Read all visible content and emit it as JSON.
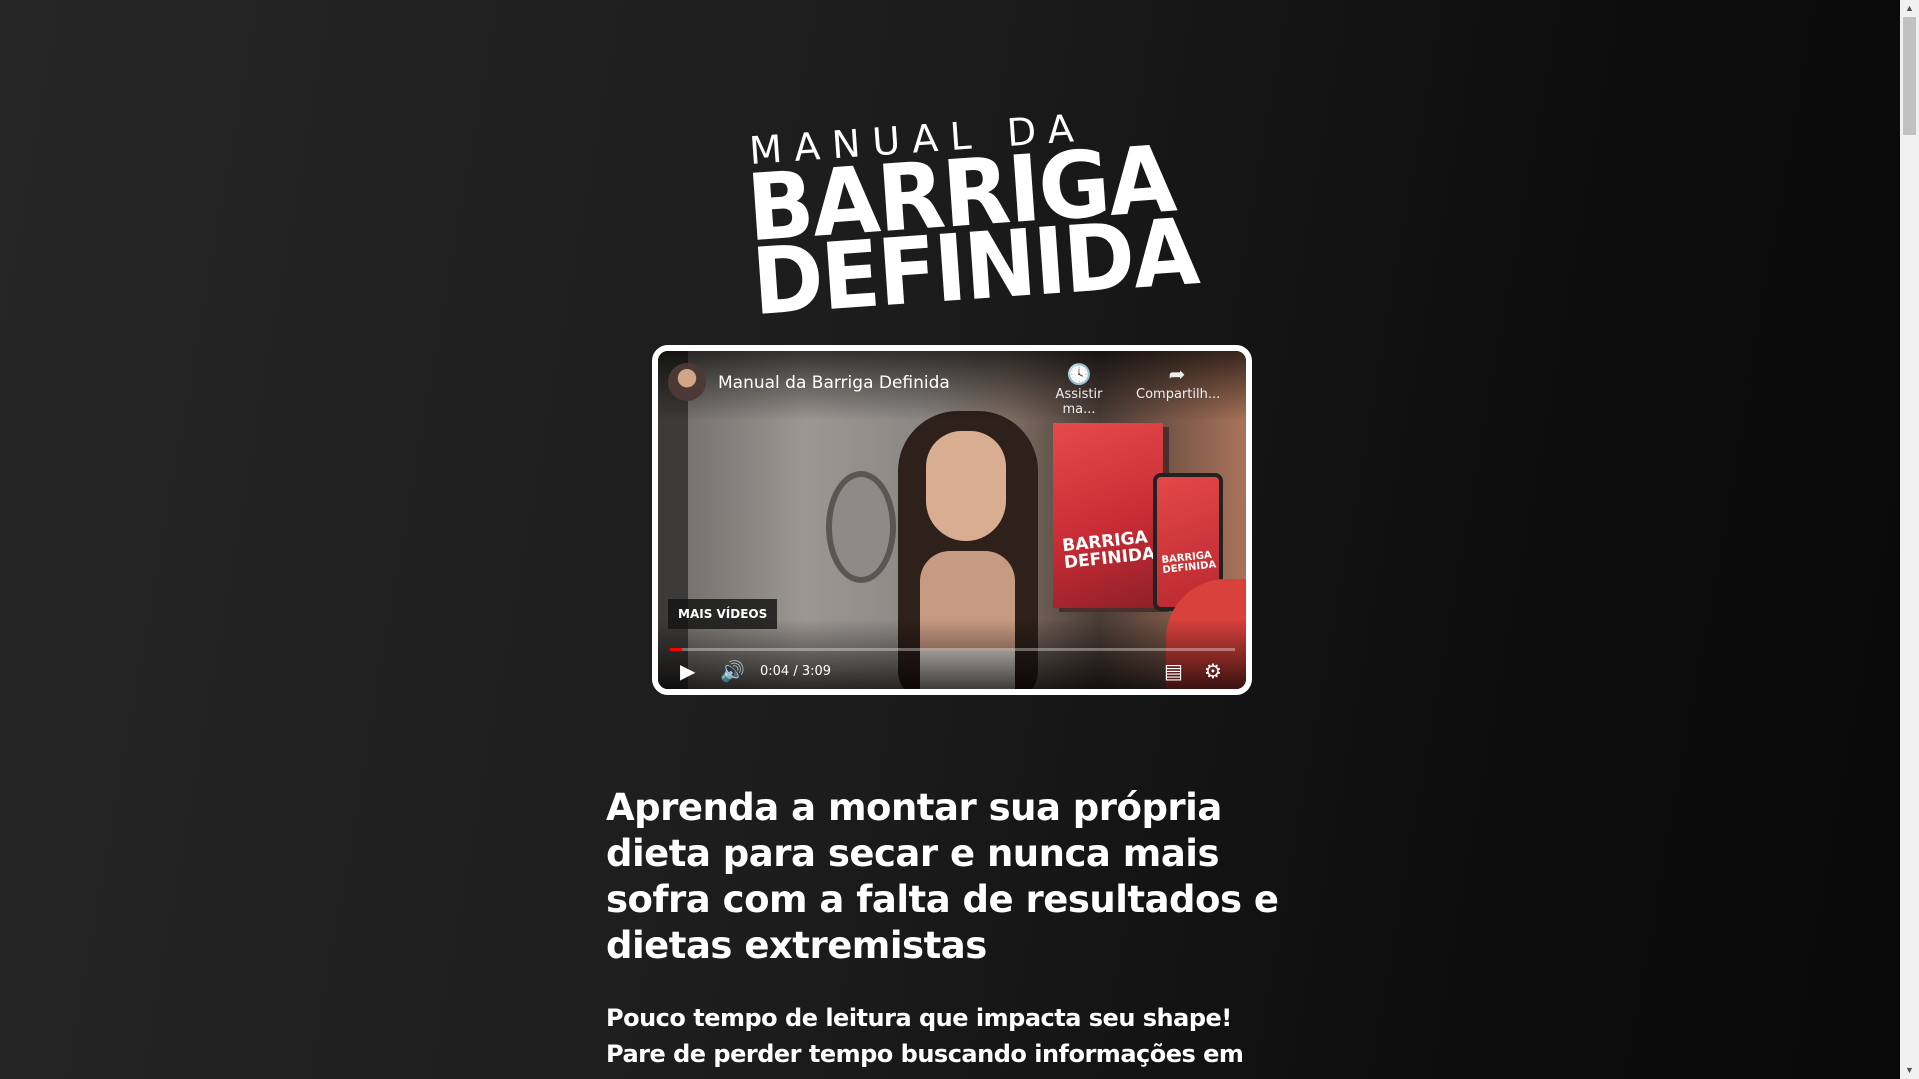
{
  "logo": {
    "line1": "MANUAL DA",
    "line2": "BARRIGA",
    "line3": "DEFINIDA"
  },
  "video": {
    "title": "Manual da Barriga Definida",
    "watch_later_label": "Assistir ma...",
    "share_label": "Compartilh...",
    "more_videos_label": "MAIS VÍDEOS",
    "current_time": "0:04",
    "duration": "3:09",
    "time_display": "0:04 / 3:09",
    "progress_fraction": 0.021,
    "product_book_text": "BARRIGA DEFINIDA",
    "product_phone_text": "BARRIGA DEFINIDA",
    "icons": {
      "play": "play-icon",
      "volume": "volume-icon",
      "captions": "captions-icon",
      "settings": "gear-icon",
      "watch_later": "clock-icon",
      "share": "share-icon"
    }
  },
  "content": {
    "headline": "Aprenda a montar sua própria dieta para secar e nunca mais sofra com a falta de resultados e dietas extremistas",
    "subheadline": "Pouco tempo de leitura que impacta seu shape! Pare de perder tempo buscando informações em todos os lugares da internet!"
  },
  "colors": {
    "background": "#1c1c1c",
    "progress": "#ff0000",
    "frame_border": "#ffffff"
  }
}
